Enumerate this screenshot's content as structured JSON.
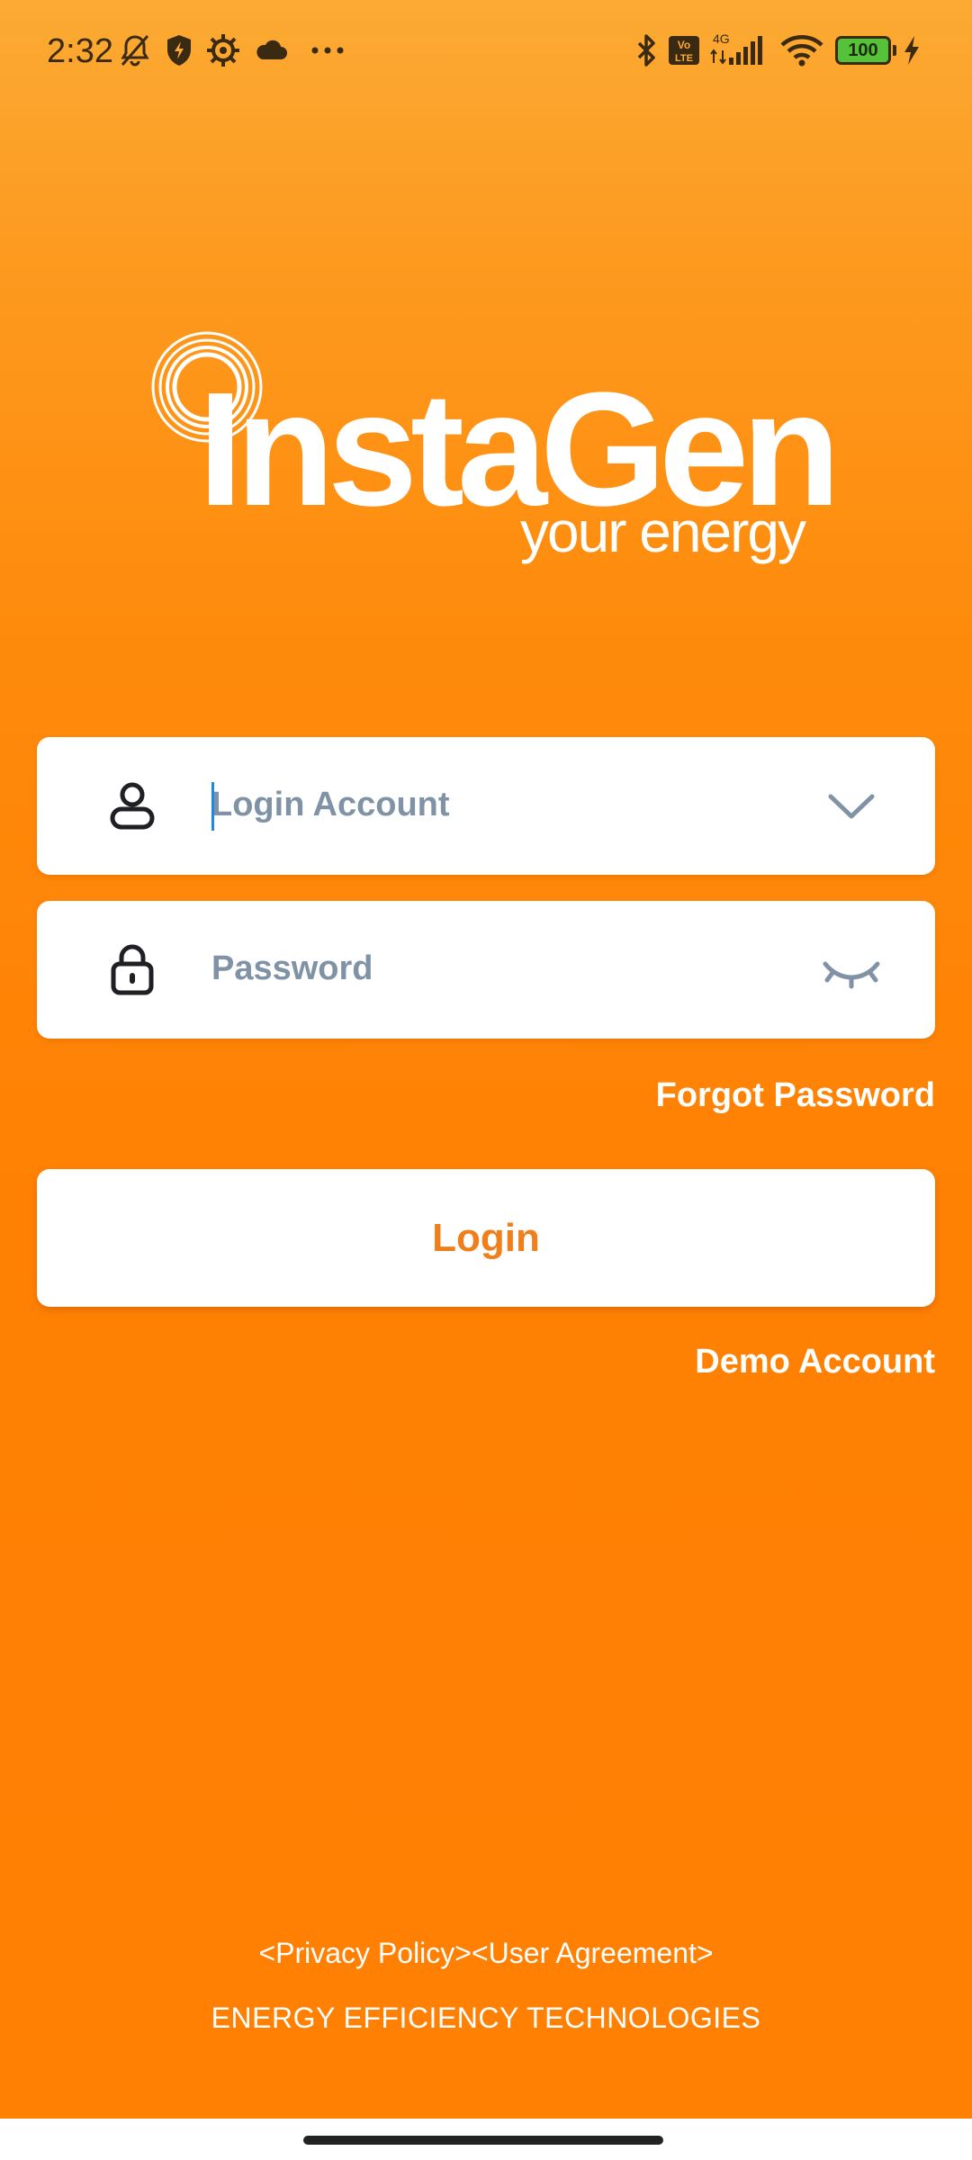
{
  "status_bar": {
    "time": "2:32",
    "battery": "100",
    "network": "4G",
    "volte": "Vo LTE",
    "icons": [
      "notifications-off-icon",
      "shield-bolt-icon",
      "settings-gear-icon",
      "cloud-icon",
      "more-dots-icon",
      "bluetooth-icon",
      "volte-icon",
      "signal-icon",
      "wifi-icon",
      "battery-icon",
      "charging-icon"
    ]
  },
  "logo": {
    "wordmark": "InstaGen",
    "tagline": "your energy"
  },
  "form": {
    "account_placeholder": "Login Account",
    "account_value": "",
    "password_placeholder": "Password",
    "password_value": "",
    "forgot_label": "Forgot Password",
    "login_label": "Login",
    "demo_label": "Demo Account"
  },
  "footer": {
    "privacy_label": "<Privacy Policy>",
    "agreement_label": "<User Agreement>",
    "company": "ENERGY EFFICIENCY TECHNOLOGIES"
  },
  "colors": {
    "background_top": "#FBAA34",
    "background_bottom": "#FF8003",
    "accent": "#EF7F1A",
    "placeholder": "#8093A6"
  }
}
